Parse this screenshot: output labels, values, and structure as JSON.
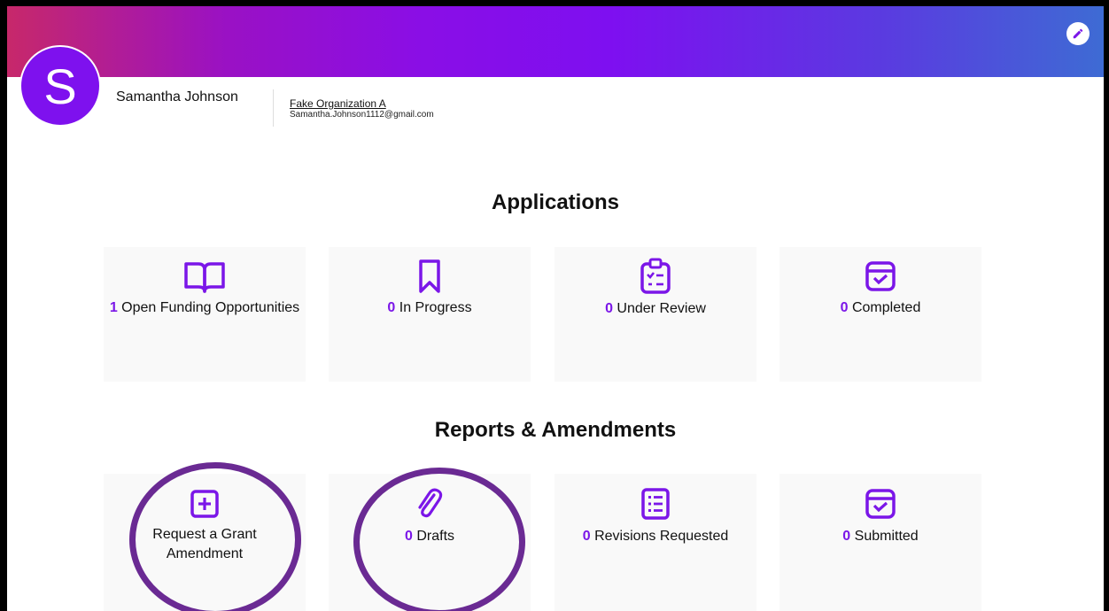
{
  "header": {
    "edit_icon": "pencil-icon",
    "avatar_letter": "S",
    "user_name": "Samantha Johnson",
    "organization": "Fake Organization A",
    "email": "Samantha.Johnson1112@gmail.com"
  },
  "colors": {
    "accent": "#7b16e8",
    "card_bg": "#f9f9f9",
    "annotation": "#6a2a93"
  },
  "applications": {
    "title": "Applications",
    "cards": [
      {
        "icon": "book-open-icon",
        "count": "1",
        "label": " Open Funding Opportunities"
      },
      {
        "icon": "bookmark-icon",
        "count": "0",
        "label": " In Progress"
      },
      {
        "icon": "clipboard-checklist-icon",
        "count": "0",
        "label": " Under Review"
      },
      {
        "icon": "archive-check-icon",
        "count": "0",
        "label": " Completed"
      }
    ]
  },
  "reports": {
    "title": "Reports & Amendments",
    "cards": [
      {
        "icon": "plus-square-icon",
        "label": "Request a Grant Amendment"
      },
      {
        "icon": "paperclip-icon",
        "count": "0",
        "label": " Drafts"
      },
      {
        "icon": "list-icon",
        "count": "0",
        "label": " Revisions Requested"
      },
      {
        "icon": "archive-check-icon",
        "count": "0",
        "label": " Submitted"
      }
    ]
  }
}
